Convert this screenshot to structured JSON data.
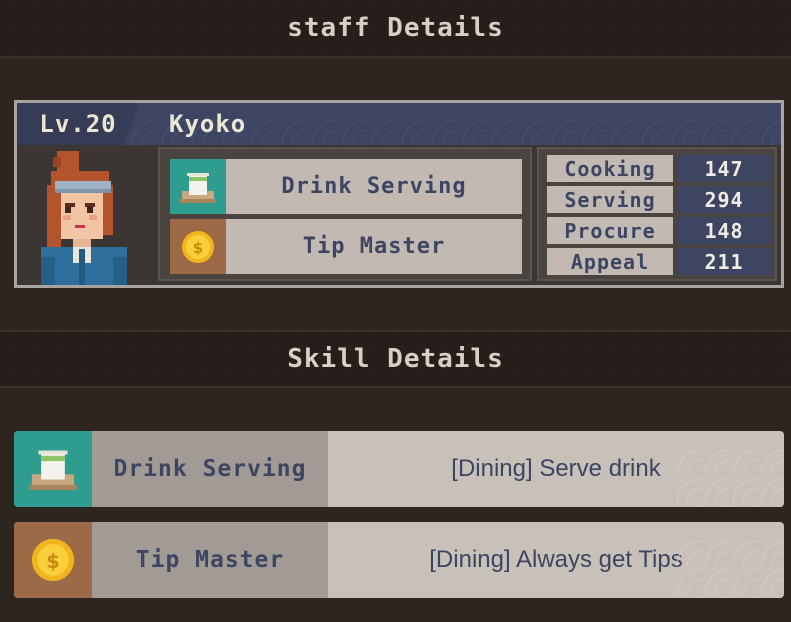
{
  "staff_details": {
    "title": "staff Details",
    "level": "Lv.20",
    "name": "Kyoko",
    "skills": [
      {
        "label": "Drink Serving",
        "icon": "tea-cup-icon",
        "color": "#2e9c8e"
      },
      {
        "label": "Tip Master",
        "icon": "gold-coin-icon",
        "color": "#9c6a46"
      }
    ],
    "stats": [
      {
        "label": "Cooking",
        "value": "147"
      },
      {
        "label": "Serving",
        "value": "294"
      },
      {
        "label": "Procure",
        "value": "148"
      },
      {
        "label": "Appeal",
        "value": "211"
      }
    ]
  },
  "skill_details": {
    "title": "Skill Details",
    "items": [
      {
        "name": "Drink Serving",
        "description": "[Dining] Serve drink",
        "icon": "tea-cup-icon"
      },
      {
        "name": "Tip Master",
        "description": "[Dining] Always get Tips",
        "icon": "gold-coin-icon"
      }
    ]
  },
  "colors": {
    "background": "#2e2521",
    "accent_navy": "#3d4563",
    "panel_beige": "#c2bab2",
    "skill_green": "#2e9c8e",
    "skill_brown": "#9c6a46"
  }
}
